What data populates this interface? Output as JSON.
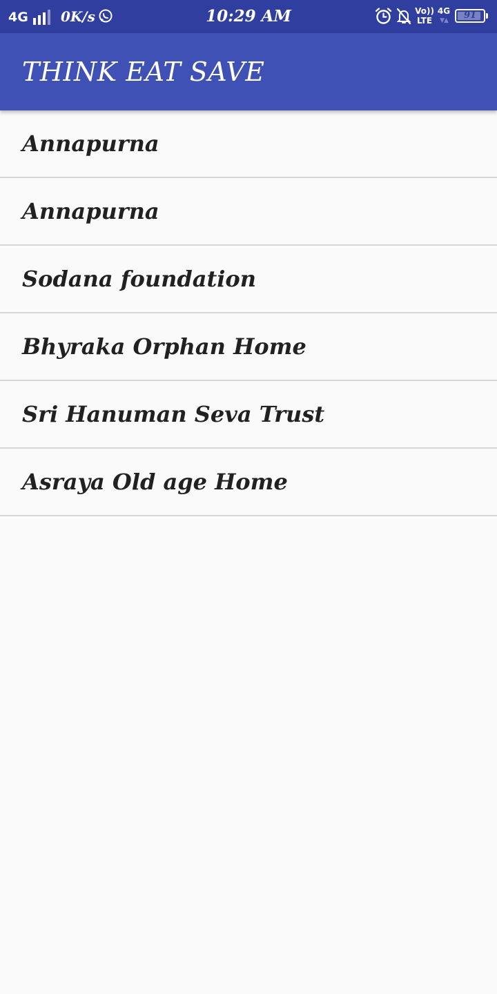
{
  "status_bar": {
    "network": "4G",
    "speed": "0K/s",
    "time": "10:29 AM",
    "volte_top": "Vo))",
    "volte_bottom": "LTE",
    "network_right": "4G",
    "battery": "91",
    "battery_level": 0.91,
    "icons": [
      "signal-icon",
      "whatsapp-icon",
      "alarm-icon",
      "notifications-off-icon",
      "volte-icon",
      "battery-icon"
    ]
  },
  "app_bar": {
    "title": "THINK EAT SAVE"
  },
  "list": {
    "items": [
      {
        "label": "Annapurna"
      },
      {
        "label": "Annapurna"
      },
      {
        "label": "Sodana foundation"
      },
      {
        "label": "Bhyraka Orphan Home"
      },
      {
        "label": "Sri Hanuman Seva Trust"
      },
      {
        "label": "Asraya Old age Home"
      }
    ]
  },
  "colors": {
    "status_bar": "#303f9f",
    "app_bar": "#3f51b5",
    "background": "#fafafa",
    "divider": "#d6d6d6",
    "text": "#212121"
  }
}
